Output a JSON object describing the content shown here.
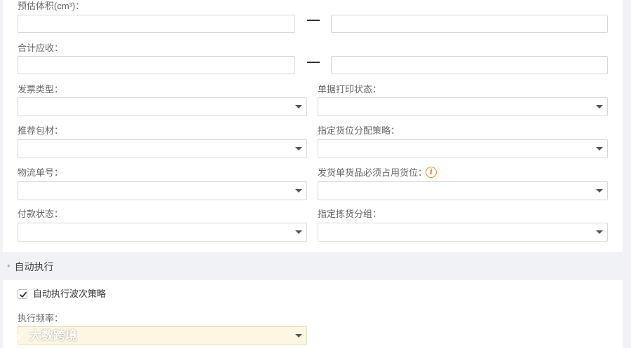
{
  "form": {
    "volume_label": "预估体积(cm³)：",
    "total_label": "合计应收：",
    "range_separator": "—",
    "invoice_type_label": "发票类型：",
    "print_status_label": "单据打印状态：",
    "packaging_label": "推荐包材：",
    "location_strategy_label": "指定货位分配策略：",
    "logistics_no_label": "物流单号：",
    "must_occupy_label": "发货单货品必须占用货位：",
    "payment_status_label": "付款状态：",
    "picking_group_label": "指定拣货分组："
  },
  "auto_exec": {
    "section_title": "自动执行",
    "required_mark": "*",
    "checkbox_label": "自动执行波次策略",
    "checkbox_checked": true,
    "frequency_label": "执行频率："
  },
  "watermark": {
    "text": "大数跨境"
  },
  "colors": {
    "info_icon": "#f08a24",
    "frequency_select_bg": "#fdf6e3",
    "page_bg": "#f0f2f5",
    "panel_bg": "#ffffff"
  }
}
